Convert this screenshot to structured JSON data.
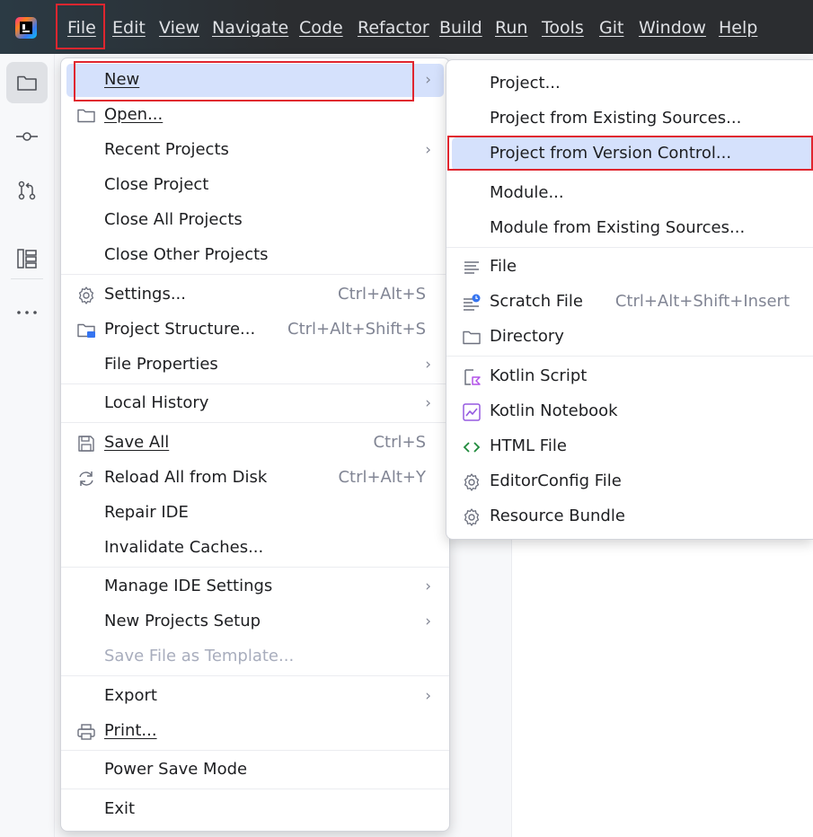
{
  "menubar": {
    "items": [
      "File",
      "Edit",
      "View",
      "Navigate",
      "Code",
      "Refactor",
      "Build",
      "Run",
      "Tools",
      "Git",
      "Window",
      "Help"
    ]
  },
  "toolstrip": {
    "icons": [
      "folder-icon",
      "commit-icon",
      "pull-requests-icon",
      "structure-icon",
      "more-icon"
    ]
  },
  "file_menu": {
    "new": "New",
    "open": "Open...",
    "recent_projects": "Recent Projects",
    "close_project": "Close Project",
    "close_all_projects": "Close All Projects",
    "close_other_projects": "Close Other Projects",
    "settings": "Settings...",
    "settings_shortcut": "Ctrl+Alt+S",
    "project_structure": "Project Structure...",
    "project_structure_shortcut": "Ctrl+Alt+Shift+S",
    "file_properties": "File Properties",
    "local_history": "Local History",
    "save_all": "Save All",
    "save_all_shortcut": "Ctrl+S",
    "reload_all": "Reload All from Disk",
    "reload_all_shortcut": "Ctrl+Alt+Y",
    "repair_ide": "Repair IDE",
    "invalidate_caches": "Invalidate Caches...",
    "manage_ide_settings": "Manage IDE Settings",
    "new_projects_setup": "New Projects Setup",
    "save_as_template": "Save File as Template...",
    "export": "Export",
    "print": "Print...",
    "power_save_mode": "Power Save Mode",
    "exit": "Exit"
  },
  "new_submenu": {
    "project": "Project...",
    "project_existing": "Project from Existing Sources...",
    "project_vcs": "Project from Version Control...",
    "module": "Module...",
    "module_existing": "Module from Existing Sources...",
    "file": "File",
    "scratch_file": "Scratch File",
    "scratch_file_shortcut": "Ctrl+Alt+Shift+Insert",
    "directory": "Directory",
    "kotlin_script": "Kotlin Script",
    "kotlin_notebook": "Kotlin Notebook",
    "html_file": "HTML File",
    "editorconfig_file": "EditorConfig File",
    "resource_bundle": "Resource Bundle"
  },
  "colors": {
    "titlebar": "#2b2d30",
    "selection": "#d5e1fc",
    "annotation_red": "#e0262f"
  }
}
